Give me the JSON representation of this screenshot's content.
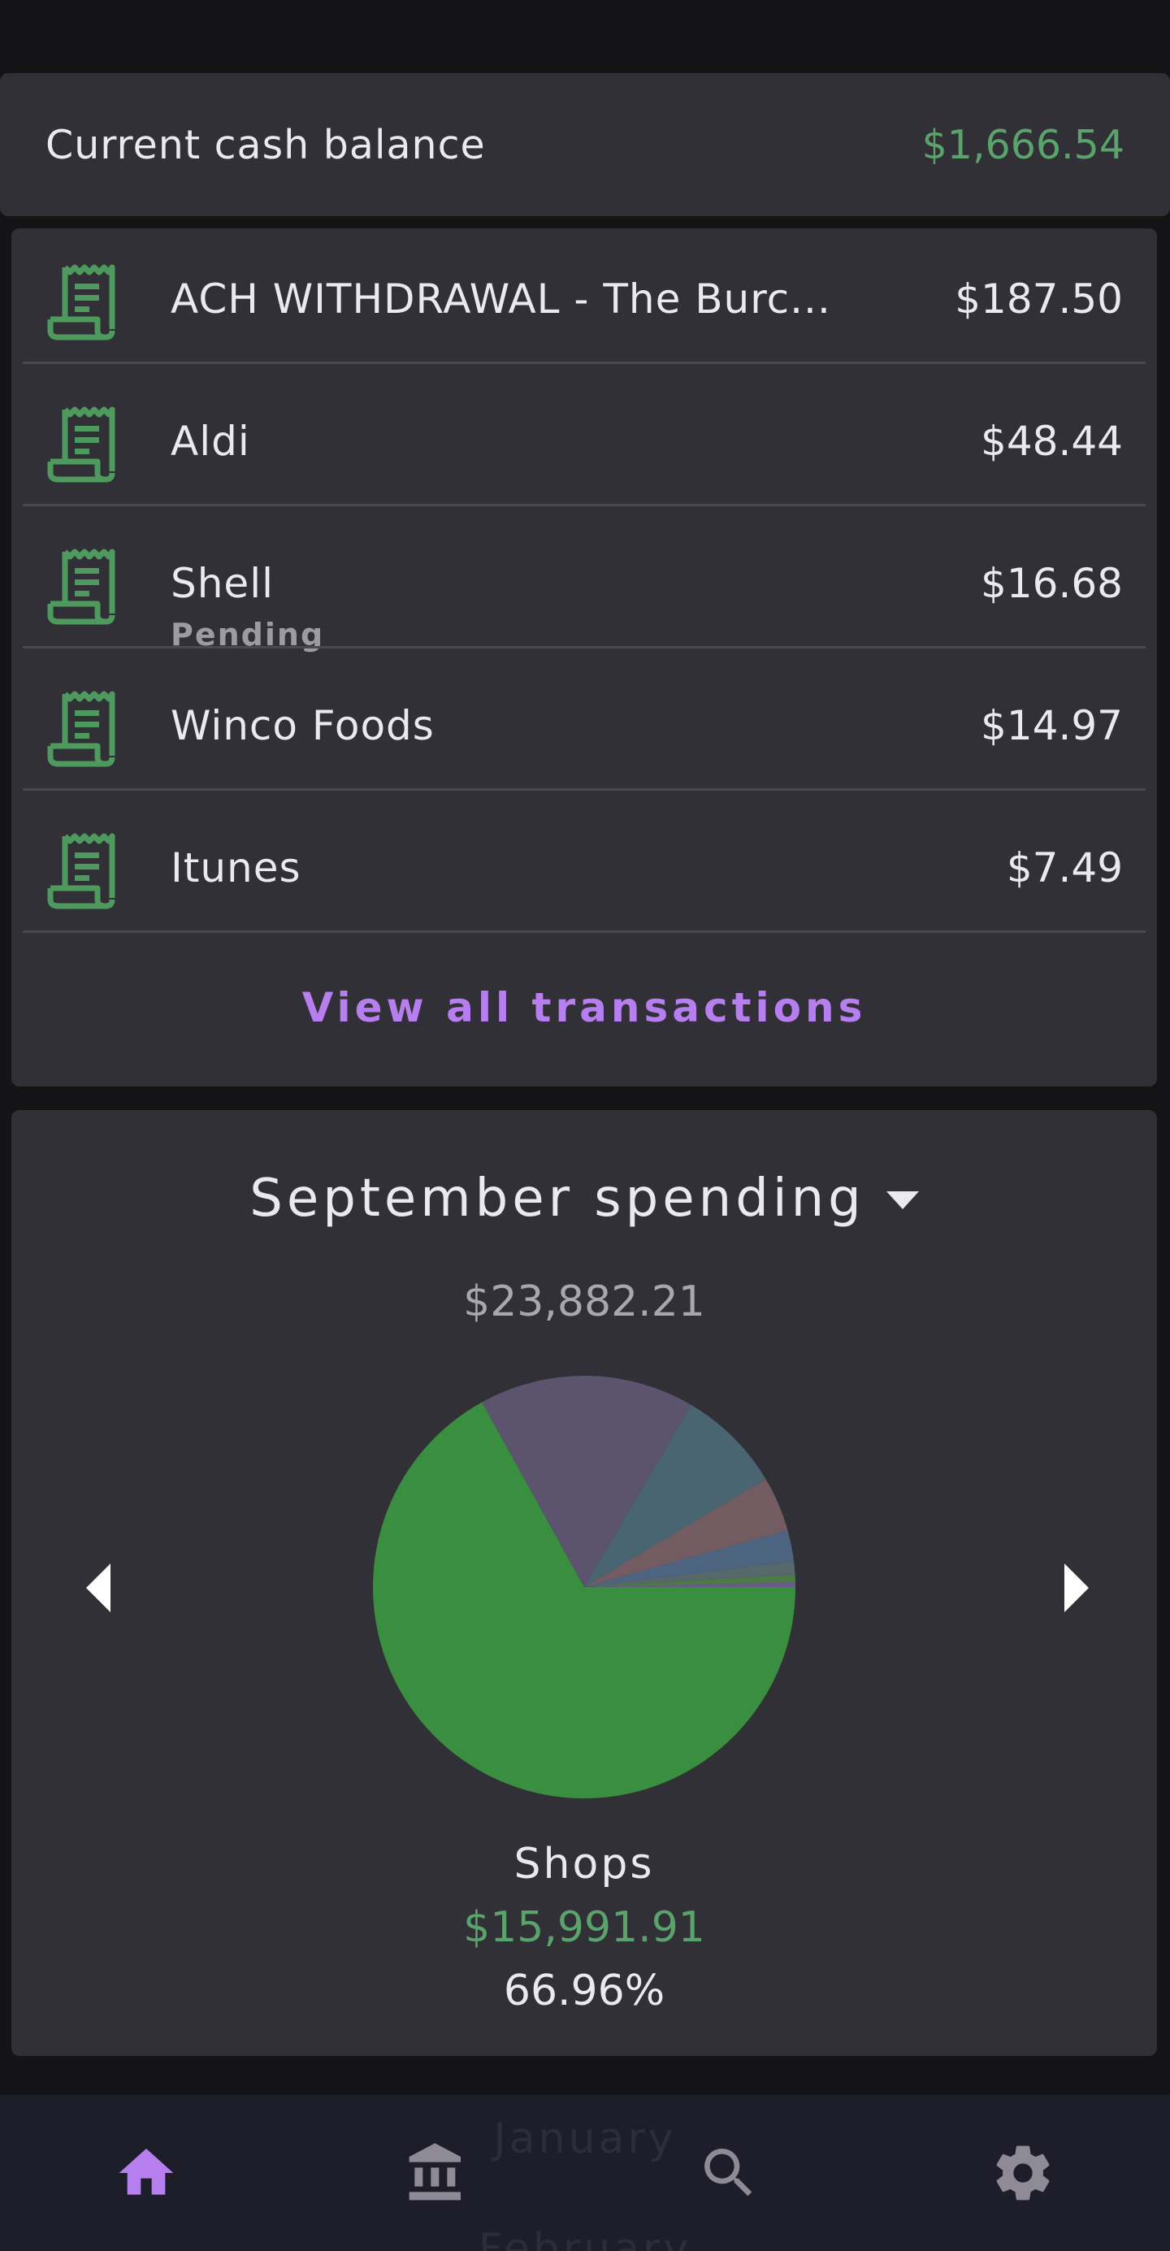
{
  "balance": {
    "label": "Current cash balance",
    "value": "$1,666.54"
  },
  "transactions": [
    {
      "name": "ACH WITHDRAWAL - The Burc...",
      "amount": "$187.50",
      "status": "",
      "icon": "receipt-icon"
    },
    {
      "name": "Aldi",
      "amount": "$48.44",
      "status": "",
      "icon": "receipt-icon"
    },
    {
      "name": "Shell",
      "amount": "$16.68",
      "status": "Pending",
      "icon": "receipt-icon"
    },
    {
      "name": "Winco Foods",
      "amount": "$14.97",
      "status": "",
      "icon": "receipt-icon"
    },
    {
      "name": "Itunes",
      "amount": "$7.49",
      "status": "",
      "icon": "receipt-icon"
    }
  ],
  "view_all_label": "View all transactions",
  "spending": {
    "title": "September spending",
    "total": "$23,882.21",
    "selected": {
      "name": "Shops",
      "amount": "$15,991.91",
      "percent": "66.96%"
    }
  },
  "chart_data": {
    "type": "pie",
    "slices": [
      {
        "label": "Shops",
        "percent": 66.96,
        "color": "#3a8e3f"
      },
      {
        "percent": 16.5,
        "color": "#5c536e"
      },
      {
        "percent": 8.0,
        "color": "#486571"
      },
      {
        "percent": 4.2,
        "color": "#725c62"
      },
      {
        "percent": 2.4,
        "color": "#4d6480"
      },
      {
        "percent": 1.0,
        "color": "#566869"
      },
      {
        "percent": 0.6,
        "color": "#4e7a4a"
      },
      {
        "percent": 0.34,
        "color": "#6a5a8a"
      }
    ]
  },
  "bottom_nav": {
    "items": [
      {
        "name": "home-icon",
        "active": true
      },
      {
        "name": "bank-icon",
        "active": false
      },
      {
        "name": "search-icon",
        "active": false
      },
      {
        "name": "settings-icon",
        "active": false
      }
    ],
    "ghost_labels": [
      "January",
      "February"
    ]
  },
  "colors": {
    "background": "#141416",
    "card": "#323037",
    "accent": "#b77ef0",
    "positive": "#5aa46c",
    "nav_background": "#1e1d2a"
  }
}
